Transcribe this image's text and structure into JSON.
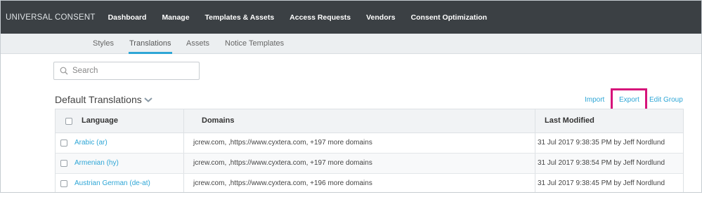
{
  "app": {
    "brand": "UNIVERSAL CONSENT",
    "nav": [
      "Dashboard",
      "Manage",
      "Templates & Assets",
      "Access Requests",
      "Vendors",
      "Consent Optimization"
    ]
  },
  "subnav": {
    "tabs": [
      "Styles",
      "Translations",
      "Assets",
      "Notice Templates"
    ],
    "active": "Translations"
  },
  "search": {
    "placeholder": "Search",
    "value": ""
  },
  "section": {
    "title": "Default Translations",
    "actions": {
      "import": "Import",
      "export": "Export",
      "edit_group": "Edit Group"
    },
    "highlight": "#d6137a"
  },
  "table": {
    "headers": {
      "language": "Language",
      "domains": "Domains",
      "last_modified": "Last Modified"
    },
    "rows": [
      {
        "language": "Arabic (ar)",
        "domains": "jcrew.com, ,https://www.cyxtera.com, +197 more domains",
        "last_modified": "31 Jul 2017 9:38:35 PM by Jeff Nordlund"
      },
      {
        "language": "Armenian (hy)",
        "domains": "jcrew.com, ,https://www.cyxtera.com, +197 more domains",
        "last_modified": "31 Jul 2017 9:38:54 PM by Jeff Nordlund"
      },
      {
        "language": "Austrian German (de-at)",
        "domains": "jcrew.com, ,https://www.cyxtera.com, +196 more domains",
        "last_modified": "31 Jul 2017 9:38:45 PM by Jeff Nordlund"
      }
    ]
  },
  "colors": {
    "navbar": "#3b4044",
    "subnav": "#eceff1",
    "accent": "#2ea6d6"
  }
}
